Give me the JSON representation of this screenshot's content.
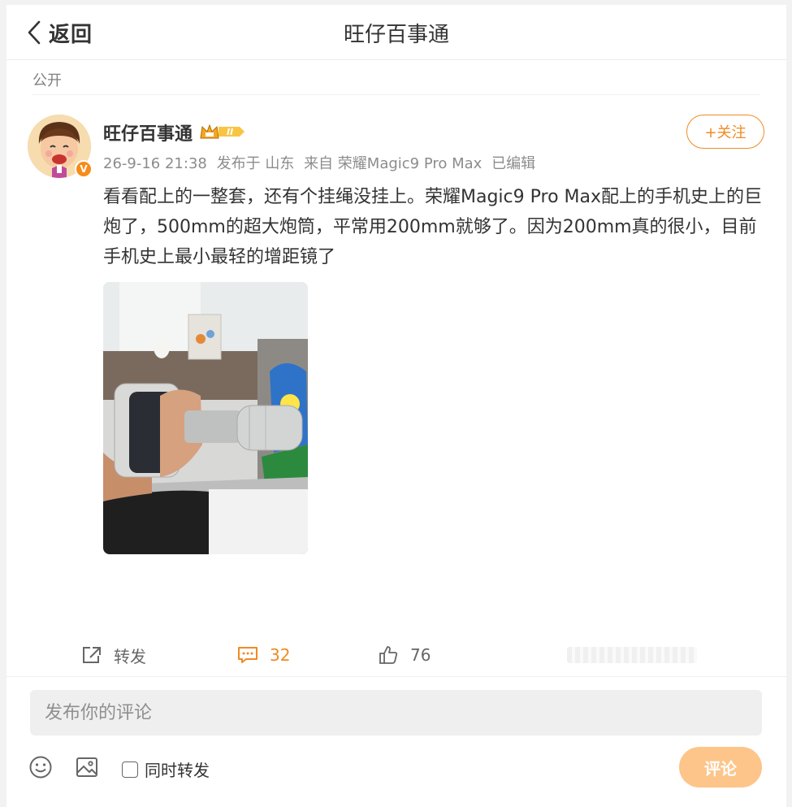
{
  "header": {
    "back_label": "返回",
    "title": "旺仔百事通"
  },
  "visibility": "公开",
  "author": {
    "name": "旺仔百事通",
    "verified_badge": "V",
    "level_badge": "II"
  },
  "follow_button": "+关注",
  "meta": {
    "time": "26-9-16 21:38",
    "location": "发布于 山东",
    "source": "来自 荣耀Magic9 Pro Max",
    "edited": "已编辑"
  },
  "post": {
    "text": "看看配上的一整套，还有个挂绳没挂上。荣耀Magic9 Pro Max配上的手机史上的巨炮了，500mm的超大炮筒，平常用200mm就够了。因为200mm真的很小，目前手机史上最小最轻的增距镜了",
    "image_icon": "phone-camera-with-telephoto-lens-photo"
  },
  "actions": {
    "repost_label": "转发",
    "comment_count": "32",
    "like_count": "76"
  },
  "comment_box": {
    "placeholder": "发布你的评论",
    "repost_label": "同时转发",
    "submit_label": "评论"
  },
  "colors": {
    "accent": "#f08a24",
    "submit_bg": "#fdc58a",
    "badge": "#f78b17"
  }
}
